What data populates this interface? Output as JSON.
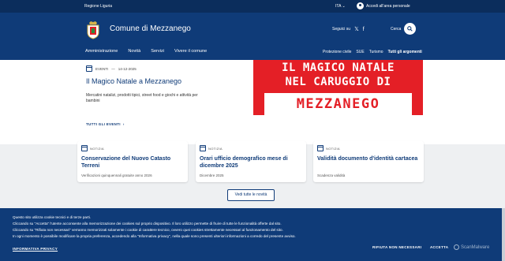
{
  "topbar": {
    "region": "Regione Liguria",
    "language": "ITA",
    "login": "Accedi all'area personale"
  },
  "header": {
    "site_title": "Comune di Mezzanego",
    "social_label": "Seguici su",
    "social_icons": [
      "x-icon",
      "facebook-icon"
    ],
    "search_label": "Cerca",
    "nav_main": [
      "Amministrazione",
      "Novità",
      "Servizi",
      "Vivere il comune"
    ],
    "nav_secondary": [
      "Protezione civile",
      "SUE",
      "Turismo",
      "Tutti gli argomenti"
    ]
  },
  "hero": {
    "category": "EVENTI",
    "date": "14-12-2025",
    "title": "Il Magico Natale a Mezzanego",
    "description": "Mercatini natalizi, prodotti tipici, street food e giochi e attività per bambini",
    "link": "TUTTI GLI EVENTI",
    "image_lines": [
      "IL MAGICO NATALE",
      "NEL CARUGGIO DI",
      "MEZZANEGO"
    ],
    "image_color": "#e41f26"
  },
  "news": {
    "cards": [
      {
        "category": "NOTIZIA",
        "title": "Conservazione del Nuovo Catasto Terreni",
        "subtitle": "Verificazioni quinquennali gratuite anno 2026"
      },
      {
        "category": "NOTIZIA",
        "title": "Orari ufficio demografico mese di dicembre 2025",
        "subtitle": "Dicembre 2025"
      },
      {
        "category": "NOTIZIA",
        "title": "Validità documento d'identità cartacea",
        "subtitle": "Scadenza validità"
      }
    ],
    "all_button": "Vedi tutte le novità"
  },
  "cookie": {
    "lines": [
      "Questo sito utilizza cookie tecnici e di terze parti.",
      "Cliccando su \"Accetta\" l'utente acconsente alla memorizzazione dei cookies sul proprio dispositivo. Il loro utilizzo permette di fruire di tutte le funzionalità offerte dal sito.",
      "Cliccando su \"Rifiuta non necessari\" verranno memorizzati solamente i cookie di carattere tecnico, ovvero quei cookies strettamente necessari al funzionamento del sito.",
      "In ogni momento è possibile modificare la propria preferenza, accedendo alla \"Informativa privacy\", nella quale sono presenti ulteriori informazioni a corredo del presente avviso."
    ],
    "privacy_link": "INFORMATIVA PRIVACY",
    "reject": "RIFIUTA NON NECESSARI",
    "accept": "ACCETTA",
    "brand": "ScanMalware"
  },
  "colors": {
    "primary": "#0f3b78",
    "topbar": "#0b2d5c",
    "section_bg": "#eef0f2"
  }
}
